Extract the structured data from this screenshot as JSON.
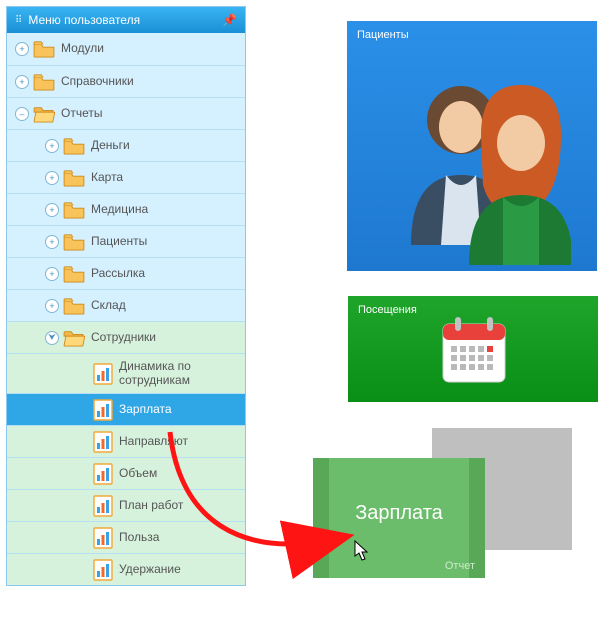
{
  "sidebar": {
    "title": "Меню пользователя",
    "items": {
      "modules": "Модули",
      "refs": "Справочники",
      "reports": "Отчеты",
      "money": "Деньги",
      "card": "Карта",
      "medicine": "Медицина",
      "patients": "Пациенты",
      "mailing": "Рассылка",
      "stock": "Склад",
      "staff": "Сотрудники",
      "dynamics": "Динамика по сотрудникам",
      "salary": "Зарплата",
      "referrers": "Направляют",
      "volume": "Объем",
      "workplan": "План работ",
      "benefit": "Польза",
      "retention": "Удержание"
    }
  },
  "tiles": {
    "patients": "Пациенты",
    "visits": "Посещения",
    "salary_big": "Зарплата",
    "salary_sub": "Отчет"
  },
  "symbols": {
    "plus": "+",
    "minus": "–",
    "down": "⮟"
  },
  "colors": {
    "primary_blue": "#2fa7e7",
    "tree_bg": "#d5f0ff",
    "tree_green": "#d7f2dc",
    "tile_blue": "#2b90e8",
    "tile_green": "#1ea52a",
    "tile_sal": "#6bbd6b",
    "arrow": "#ff1414"
  }
}
